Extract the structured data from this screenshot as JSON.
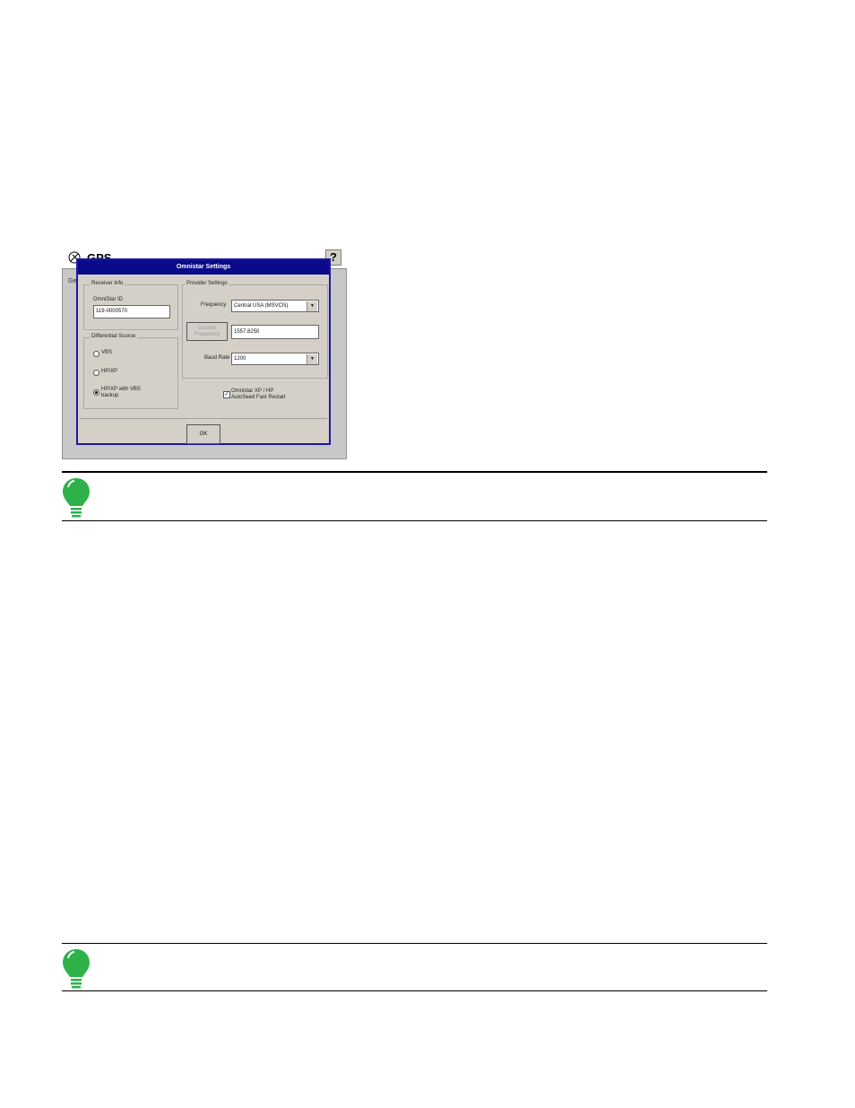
{
  "gps_window": {
    "title": "GPS",
    "help_label": "?",
    "tab_stub": "Ge"
  },
  "dialog": {
    "title": "Omnistar Settings",
    "receiver_info": {
      "group_label": "Receiver Info",
      "omnistar_id_label": "OmniStar ID",
      "omnistar_id_value": "119-0000570"
    },
    "differential_source": {
      "group_label": "Differential Source",
      "options": [
        {
          "label": "VBS",
          "selected": false
        },
        {
          "label": "HP/XP",
          "selected": false
        },
        {
          "label": "HP/XP with VBS backup",
          "selected": true
        }
      ]
    },
    "provider_settings": {
      "group_label": "Provider Settings",
      "frequency_label": "Frequency",
      "frequency_value": "Central USA (MSVCN)",
      "custom_frequency_label": "Custom Frequency",
      "custom_frequency_value": "1557.8250",
      "baud_rate_label": "Baud Rate",
      "baud_rate_value": "1200"
    },
    "autoseed": {
      "checked": true,
      "label_line1": "Omnistar XP / HP",
      "label_line2": "AutoSeed Fast Restart"
    },
    "ok_label": "OK"
  },
  "notes": [
    {
      "icon": "lightbulb-icon",
      "color": "#2db24a"
    },
    {
      "icon": "lightbulb-icon",
      "color": "#2db24a"
    }
  ]
}
